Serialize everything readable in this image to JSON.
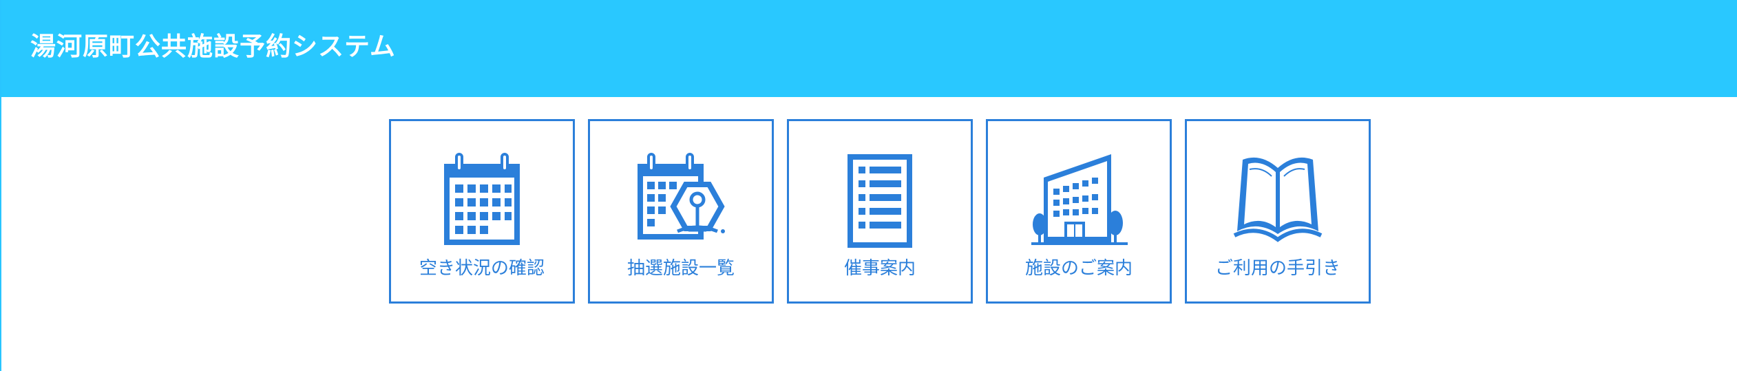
{
  "header": {
    "title": "湯河原町公共施設予約システム"
  },
  "colors": {
    "header_bg": "#29c8ff",
    "accent": "#2b7fda",
    "background": "#ffffff"
  },
  "menu": {
    "items": [
      {
        "label": "空き状況の確認",
        "icon": "calendar-icon"
      },
      {
        "label": "抽選施設一覧",
        "icon": "lottery-calendar-icon"
      },
      {
        "label": "催事案内",
        "icon": "event-list-icon"
      },
      {
        "label": "施設のご案内",
        "icon": "building-icon"
      },
      {
        "label": "ご利用の手引き",
        "icon": "open-book-icon"
      }
    ]
  }
}
